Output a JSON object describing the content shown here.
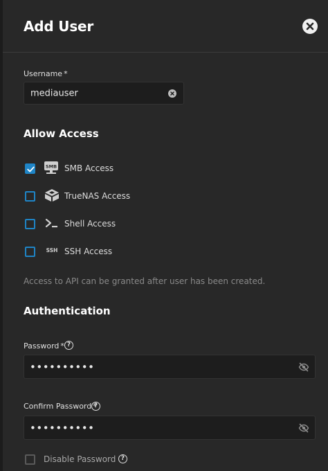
{
  "header": {
    "title": "Add User",
    "close_icon": "close-icon"
  },
  "username": {
    "label": "Username",
    "required_mark": "*",
    "value": "mediauser",
    "clear_icon": "clear-icon"
  },
  "allow_access": {
    "title": "Allow Access",
    "items": [
      {
        "label": "SMB Access",
        "icon": "smb-icon",
        "checked": true
      },
      {
        "label": "TrueNAS Access",
        "icon": "truenas-icon",
        "checked": false
      },
      {
        "label": "Shell Access",
        "icon": "shell-icon",
        "checked": false
      },
      {
        "label": "SSH Access",
        "icon": "ssh-icon",
        "checked": false
      }
    ],
    "hint": "Access to API can be granted after user has been created.",
    "smb_icon_text": "SMB",
    "ssh_icon_text": "SSH"
  },
  "authentication": {
    "title": "Authentication",
    "password": {
      "label": "Password",
      "required_mark": "*",
      "value": "••••••••••"
    },
    "confirm_password": {
      "label": "Confirm Password",
      "required_mark": "*",
      "value": "••••••••••"
    },
    "disable_password": {
      "label": "Disable Password",
      "checked": false
    },
    "help_glyph": "?"
  },
  "colors": {
    "accent": "#1f85c7",
    "background": "#282828",
    "input_bg": "#1d1d1d"
  }
}
